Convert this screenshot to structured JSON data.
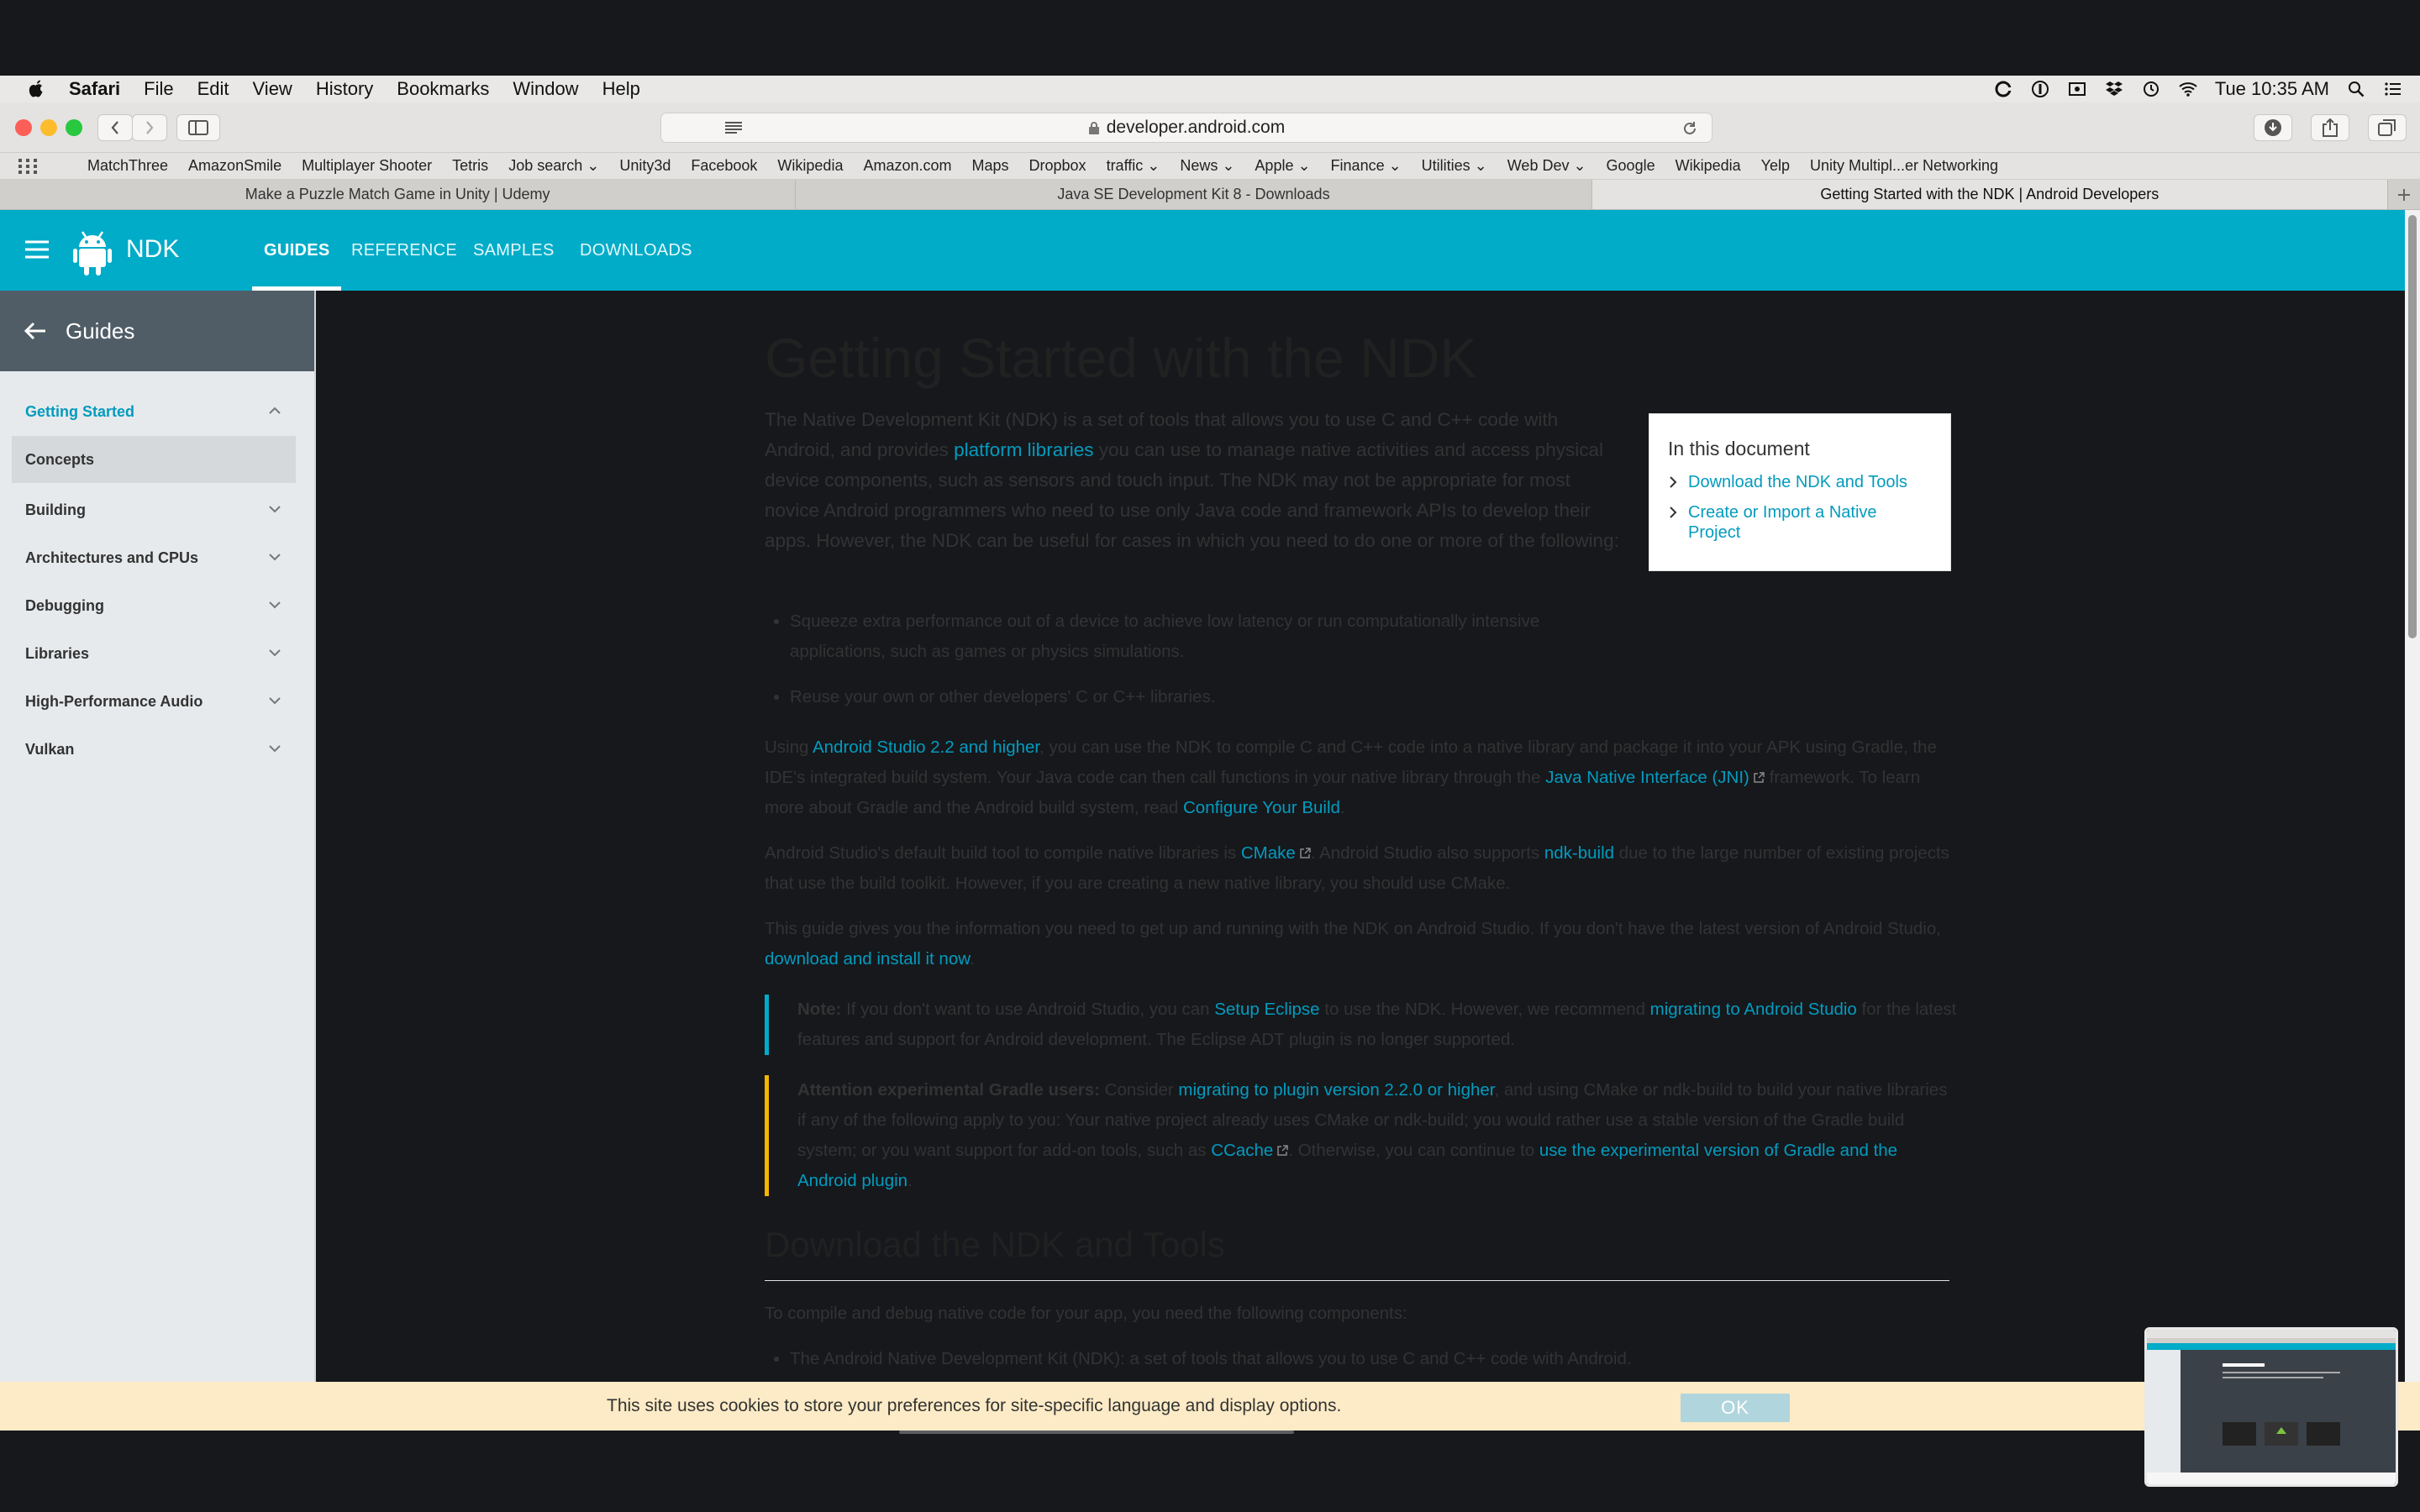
{
  "menubar": {
    "items": [
      "Safari",
      "File",
      "Edit",
      "View",
      "History",
      "Bookmarks",
      "Window",
      "Help"
    ],
    "clock": "Tue 10:35 AM"
  },
  "browser": {
    "url": "developer.android.com"
  },
  "bookmarks": [
    "MatchThree",
    "AmazonSmile",
    "Multiplayer Shooter",
    "Tetris",
    "Job search ⌄",
    "Unity3d",
    "Facebook",
    "Wikipedia",
    "Amazon.com",
    "Maps",
    "Dropbox",
    "traffic ⌄",
    "News ⌄",
    "Apple ⌄",
    "Finance ⌄",
    "Utilities ⌄",
    "Web Dev ⌄",
    "Google",
    "Wikipedia",
    "Yelp",
    "Unity Multipl...er Networking"
  ],
  "tabs": [
    "Make a Puzzle Match Game in Unity | Udemy",
    "Java SE Development Kit 8 - Downloads",
    "Getting Started with the NDK | Android Developers"
  ],
  "header": {
    "brand": "NDK",
    "nav": [
      "GUIDES",
      "REFERENCE",
      "SAMPLES",
      "DOWNLOADS"
    ]
  },
  "sidebar": {
    "title": "Guides",
    "items": [
      "Getting Started",
      "Concepts",
      "Building",
      "Architectures and CPUs",
      "Debugging",
      "Libraries",
      "High-Performance Audio",
      "Vulkan"
    ]
  },
  "content": {
    "title": "Getting Started with the NDK",
    "intro_a": "The Native Development Kit (NDK) is a set of tools that allows you to use C and C++ code with Android, and provides ",
    "intro_link": "platform libraries",
    "intro_b": " you can use to manage native activities and access physical device components, such as sensors and touch input. The NDK may not be appropriate for most novice Android programmers who need to use only Java code and framework APIs to develop their apps. However, the NDK can be useful for cases in which you need to do one or more of the following:",
    "bullets": [
      "Squeeze extra performance out of a device to achieve low latency or run computationally intensive applications, such as games or physics simulations.",
      "Reuse your own or other developers' C or C++ libraries."
    ],
    "p1": {
      "a": "Using ",
      "link1": "Android Studio 2.2 and higher",
      "b": ", you can use the NDK to compile C and C++ code into a native library and package it into your APK using Gradle, the IDE's integrated build system. Your Java code can then call functions in your native library through the ",
      "link2": "Java Native Interface (JNI)",
      "c": " framework. To learn more about Gradle and the Android build system, read ",
      "link3": "Configure Your Build",
      "d": "."
    },
    "p2": {
      "a": "Android Studio's default build tool to compile native libraries is ",
      "link1": "CMake",
      "b": ". Android Studio also supports ",
      "link2": "ndk-build",
      "c": " due to the large number of existing projects that use the build toolkit. However, if you are creating a new native library, you should use CMake."
    },
    "p3": {
      "a": "This guide gives you the information you need to get up and running with the NDK on Android Studio. If you don't have the latest version of Android Studio, ",
      "link1": "download and install it now",
      "b": "."
    },
    "note": {
      "label": "Note:",
      "a": " If you don't want to use Android Studio, you can ",
      "link1": "Setup Eclipse",
      "b": " to use the NDK. However, we recommend ",
      "link2": "migrating to Android Studio",
      "c": " for the latest features and support for Android development. The Eclipse ADT plugin is no longer supported."
    },
    "attention": {
      "label": "Attention experimental Gradle users:",
      "a": " Consider ",
      "link1": "migrating to plugin version 2.2.0 or higher",
      "b": ", and using CMake or ndk-build to build your native libraries if any of the following apply to you: Your native project already uses CMake or ndk-build; you would rather use a stable version of the Gradle build system; or you want support for add-on tools, such as ",
      "link2": "CCache",
      "c": ". Otherwise, you can continue to ",
      "link3": "use the experimental version of Gradle and the Android plugin",
      "d": "."
    },
    "h2": "Download the NDK and Tools",
    "p4": "To compile and debug native code for your app, you need the following components:",
    "bullets2": [
      "The Android Native Development Kit (NDK): a set of tools that allows you to use C and C++ code with Android."
    ]
  },
  "toc": {
    "title": "In this document",
    "items": [
      "Download the NDK and Tools",
      "Create or Import a Native Project"
    ]
  },
  "cookie": {
    "message": "This site uses cookies to store your preferences for site-specific language and display options.",
    "ok": "OK"
  },
  "colors": {
    "accent": "#00acc8",
    "link": "#039bbe",
    "sidebar_head": "#505d66",
    "note_bar": "#00acc8",
    "warn_bar": "#f4b400"
  }
}
